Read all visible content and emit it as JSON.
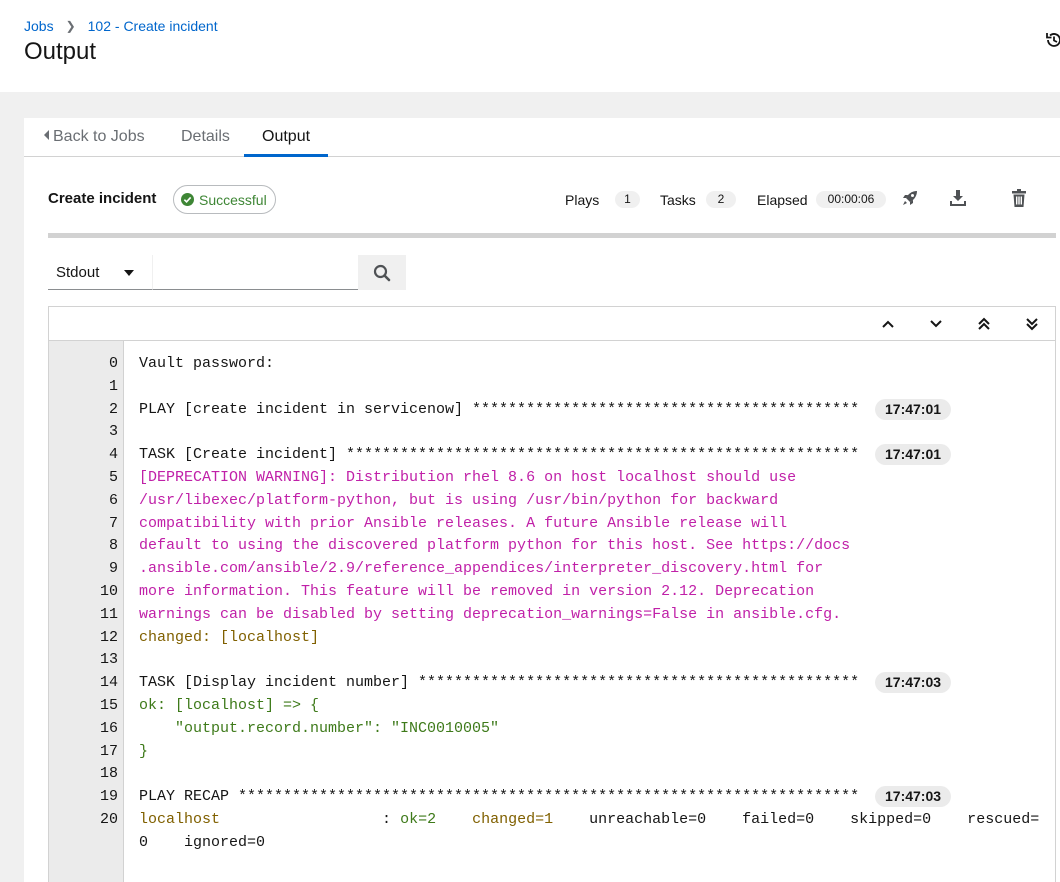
{
  "breadcrumb": {
    "jobs": "Jobs",
    "current": "102 - Create incident"
  },
  "page_title": "Output",
  "tabs": {
    "back": "Back to Jobs",
    "details": "Details",
    "output": "Output"
  },
  "job": {
    "name": "Create incident",
    "status": "Successful",
    "plays_label": "Plays",
    "plays_count": "1",
    "tasks_label": "Tasks",
    "tasks_count": "2",
    "elapsed_label": "Elapsed",
    "elapsed_value": "00:00:06"
  },
  "search": {
    "type_selected": "Stdout",
    "placeholder": ""
  },
  "icons": {
    "history": "history-icon",
    "relaunch": "rocket-icon",
    "download": "download-icon",
    "delete": "trash-icon",
    "search": "search-icon",
    "up": "angle-up-icon",
    "down": "angle-down-icon",
    "top": "angle-double-up-icon",
    "bottom": "angle-double-down-icon"
  },
  "colors": {
    "accent": "#0066cc",
    "success": "#3e8635",
    "warning_text": "#c020a8",
    "changed_text": "#806000",
    "ok_text": "#3e7a1a"
  },
  "output": {
    "lines": [
      {
        "n": "0",
        "text": "Vault password:",
        "ts": ""
      },
      {
        "n": "1",
        "text": "",
        "ts": ""
      },
      {
        "n": "2",
        "text": "PLAY [create incident in servicenow] *******************************************",
        "ts": "17:47:01"
      },
      {
        "n": "3",
        "text": "",
        "ts": ""
      },
      {
        "n": "4",
        "text": "TASK [Create incident] *********************************************************",
        "ts": "17:47:01"
      },
      {
        "n": "5",
        "text": "[DEPRECATION WARNING]: Distribution rhel 8.6 on host localhost should use",
        "ts": ""
      },
      {
        "n": "6",
        "text": "/usr/libexec/platform-python, but is using /usr/bin/python for backward",
        "ts": ""
      },
      {
        "n": "7",
        "text": "compatibility with prior Ansible releases. A future Ansible release will",
        "ts": ""
      },
      {
        "n": "8",
        "text": "default to using the discovered platform python for this host. See https://docs",
        "ts": ""
      },
      {
        "n": "9",
        "text": ".ansible.com/ansible/2.9/reference_appendices/interpreter_discovery.html for",
        "ts": ""
      },
      {
        "n": "10",
        "text": "more information. This feature will be removed in version 2.12. Deprecation",
        "ts": ""
      },
      {
        "n": "11",
        "text": "warnings can be disabled by setting deprecation_warnings=False in ansible.cfg.",
        "ts": ""
      },
      {
        "n": "12",
        "text": "changed: [localhost]",
        "ts": ""
      },
      {
        "n": "13",
        "text": "",
        "ts": ""
      },
      {
        "n": "14",
        "text": "TASK [Display incident number] *************************************************",
        "ts": "17:47:03"
      },
      {
        "n": "15",
        "text": "ok: [localhost] => {",
        "ts": ""
      },
      {
        "n": "16",
        "text": "    \"output.record.number\": \"INC0010005\"",
        "ts": ""
      },
      {
        "n": "17",
        "text": "}",
        "ts": ""
      },
      {
        "n": "18",
        "text": "",
        "ts": ""
      },
      {
        "n": "19",
        "text": "PLAY RECAP *********************************************************************",
        "ts": "17:47:03"
      },
      {
        "n": "20",
        "text": "",
        "ts": ""
      },
      {
        "n": "",
        "text": "0    ignored=0",
        "ts": ""
      }
    ],
    "recap": {
      "host": "localhost",
      "colon": ": ",
      "ok": "ok=2",
      "changed": "changed=1",
      "rest": "unreachable=0    failed=0    skipped=0    rescued="
    }
  }
}
